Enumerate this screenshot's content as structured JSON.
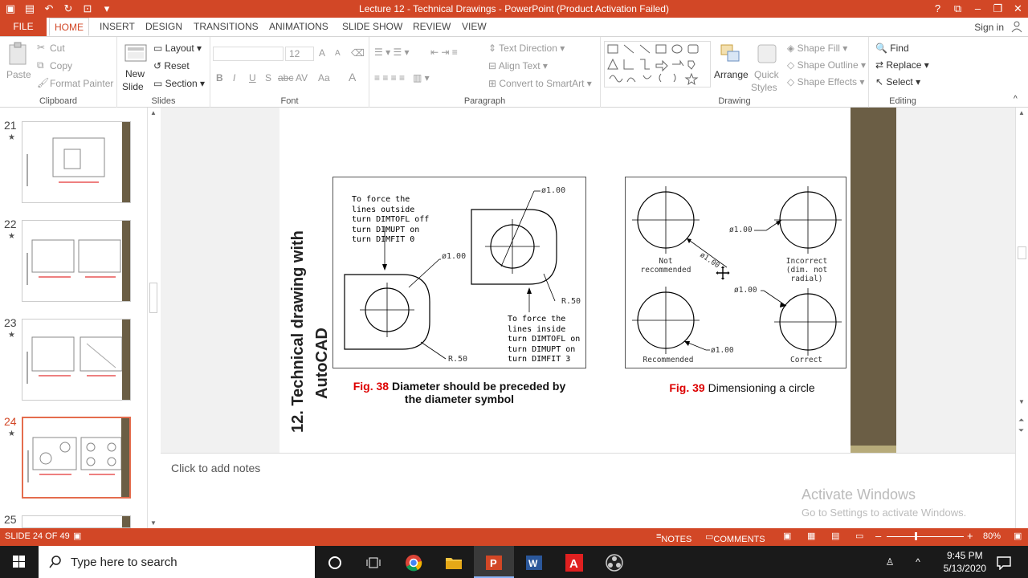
{
  "window": {
    "title": "Lecture 12 - Technical Drawings - PowerPoint (Product Activation Failed)",
    "help": "?",
    "ribbon_options": "⧉",
    "minimize": "–",
    "restore": "❐",
    "close": "✕"
  },
  "tabs": {
    "file": "FILE",
    "home": "HOME",
    "insert": "INSERT",
    "design": "DESIGN",
    "transitions": "TRANSITIONS",
    "animations": "ANIMATIONS",
    "slideshow": "SLIDE SHOW",
    "review": "REVIEW",
    "view": "VIEW",
    "signin": "Sign in"
  },
  "ribbon": {
    "clipboard": {
      "label": "Clipboard",
      "paste": "Paste",
      "cut": "Cut",
      "copy": "Copy",
      "format_painter": "Format Painter"
    },
    "slides": {
      "label": "Slides",
      "new_slide_1": "New",
      "new_slide_2": "Slide",
      "layout": "Layout",
      "reset": "Reset",
      "section": "Section"
    },
    "font": {
      "label": "Font",
      "size": "12",
      "bold": "B",
      "italic": "I",
      "underline": "U",
      "shadow": "S",
      "strike": "abc",
      "spacing": "AV",
      "case": "Aa",
      "grow": "A",
      "shrink": "A",
      "color": "A"
    },
    "paragraph": {
      "label": "Paragraph",
      "text_direction": "Text Direction",
      "align_text": "Align Text",
      "smartart": "Convert to SmartArt"
    },
    "drawing": {
      "label": "Drawing",
      "arrange": "Arrange",
      "quick_styles_1": "Quick",
      "quick_styles_2": "Styles",
      "shape_fill": "Shape Fill",
      "shape_outline": "Shape Outline",
      "shape_effects": "Shape Effects"
    },
    "editing": {
      "label": "Editing",
      "find": "Find",
      "replace": "Replace",
      "select": "Select"
    }
  },
  "thumbnails": [
    {
      "num": "21",
      "star": "★"
    },
    {
      "num": "22",
      "star": "★"
    },
    {
      "num": "23",
      "star": "★"
    },
    {
      "num": "24",
      "star": "★"
    },
    {
      "num": "25",
      "star": ""
    }
  ],
  "slide": {
    "title_line1": "12.  Technical drawing with",
    "title_line2": "AutoCAD",
    "fig38": {
      "num": "Fig. 38",
      "caption_a": " Diameter should be preceded by",
      "caption_b": "the diameter symbol",
      "note_outside": [
        "To force the",
        "lines outside",
        "turn DIMTOFL off",
        "turn DIMUPT on",
        "turn DIMFIT 0"
      ],
      "note_inside": [
        "To force the",
        "lines inside",
        "turn DIMTOFL on",
        "turn DIMUPT on",
        "turn DIMFIT 3"
      ],
      "dim_top": "ø1.00",
      "dim_left": "ø1.00",
      "r_right": "R.50",
      "r_left": "R.50"
    },
    "fig39": {
      "num": "Fig. 39",
      "caption": " Dimensioning a circle",
      "not_rec_1": "Not",
      "not_rec_2": "recommended",
      "incorrect_1": "Incorrect",
      "incorrect_2": "(dim. not radial)",
      "recommended": "Recommended",
      "correct": "Correct",
      "d1": "ø1.00",
      "d2": "ø1.00",
      "d3": "ø1.00",
      "d4": "ø1.00"
    }
  },
  "notes": {
    "placeholder": "Click to add notes"
  },
  "watermark": {
    "line1": "Activate Windows",
    "line2": "Go to Settings to activate Windows."
  },
  "status": {
    "slide_info": "SLIDE 24 OF 49",
    "notes": "NOTES",
    "comments": "COMMENTS",
    "zoom_minus": "–",
    "zoom_plus": "+",
    "zoom": "80%"
  },
  "taskbar": {
    "search_placeholder": "Type here to search",
    "time": "9:45 PM",
    "date": "5/13/2020"
  },
  "colors": {
    "accent": "#d24726",
    "slide_bar": "#6b5e45",
    "fig_number": "#dd0000"
  }
}
